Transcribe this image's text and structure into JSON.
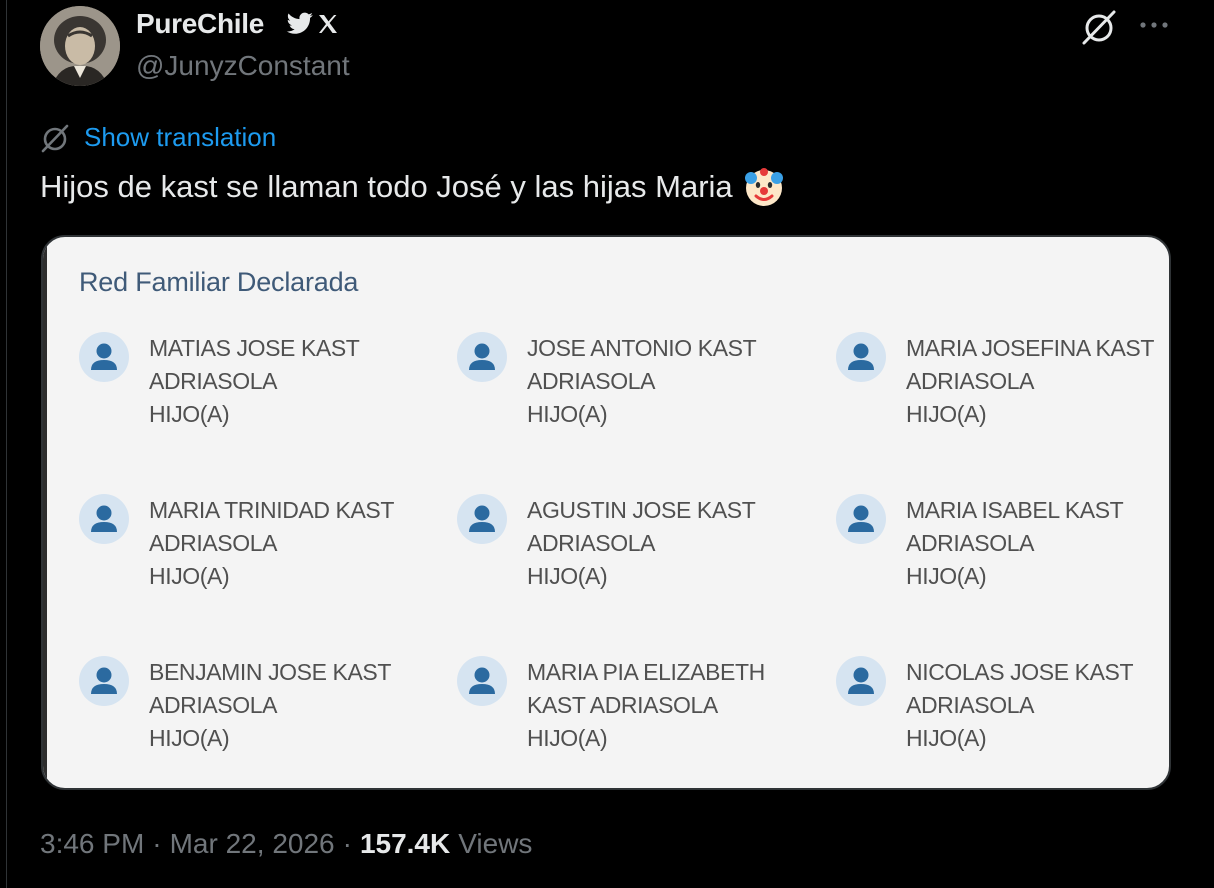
{
  "author": {
    "display_name": "PureChile",
    "handle": "@JunyzConstant",
    "badges": [
      "bird-icon",
      "x-logo-icon"
    ]
  },
  "translation": {
    "label": "Show translation"
  },
  "tweet": {
    "text": "Hijos de kast se llaman todo José y las hijas Maria",
    "emoji": "clown-face-icon"
  },
  "card": {
    "title": "Red Familiar Declarada",
    "members": [
      {
        "line1": "MATIAS JOSE KAST",
        "line2": "ADRIASOLA",
        "role": "HIJO(A)"
      },
      {
        "line1": "JOSE ANTONIO KAST",
        "line2": "ADRIASOLA",
        "role": "HIJO(A)"
      },
      {
        "line1": "MARIA JOSEFINA KAST",
        "line2": "ADRIASOLA",
        "role": "HIJO(A)"
      },
      {
        "line1": "MARIA TRINIDAD KAST",
        "line2": "ADRIASOLA",
        "role": "HIJO(A)"
      },
      {
        "line1": "AGUSTIN JOSE KAST",
        "line2": "ADRIASOLA",
        "role": "HIJO(A)"
      },
      {
        "line1": "MARIA ISABEL KAST",
        "line2": "ADRIASOLA",
        "role": "HIJO(A)"
      },
      {
        "line1": "BENJAMIN JOSE KAST",
        "line2": "ADRIASOLA",
        "role": "HIJO(A)"
      },
      {
        "line1": "MARIA PIA ELIZABETH",
        "line2": "KAST ADRIASOLA",
        "role": "HIJO(A)"
      },
      {
        "line1": "NICOLAS JOSE KAST",
        "line2": "ADRIASOLA",
        "role": "HIJO(A)"
      }
    ]
  },
  "meta": {
    "time": "3:46 PM",
    "separator": "·",
    "date": "Mar 22, 2026",
    "views_count": "157.4K",
    "views_label": "Views"
  },
  "colors": {
    "background": "#000000",
    "link": "#1d9bf0",
    "muted": "#71767b",
    "card_background": "#f4f4f4",
    "card_title": "#3f5a78",
    "person_icon": "#2b6aa0",
    "person_icon_bg": "#d6e4f1"
  }
}
